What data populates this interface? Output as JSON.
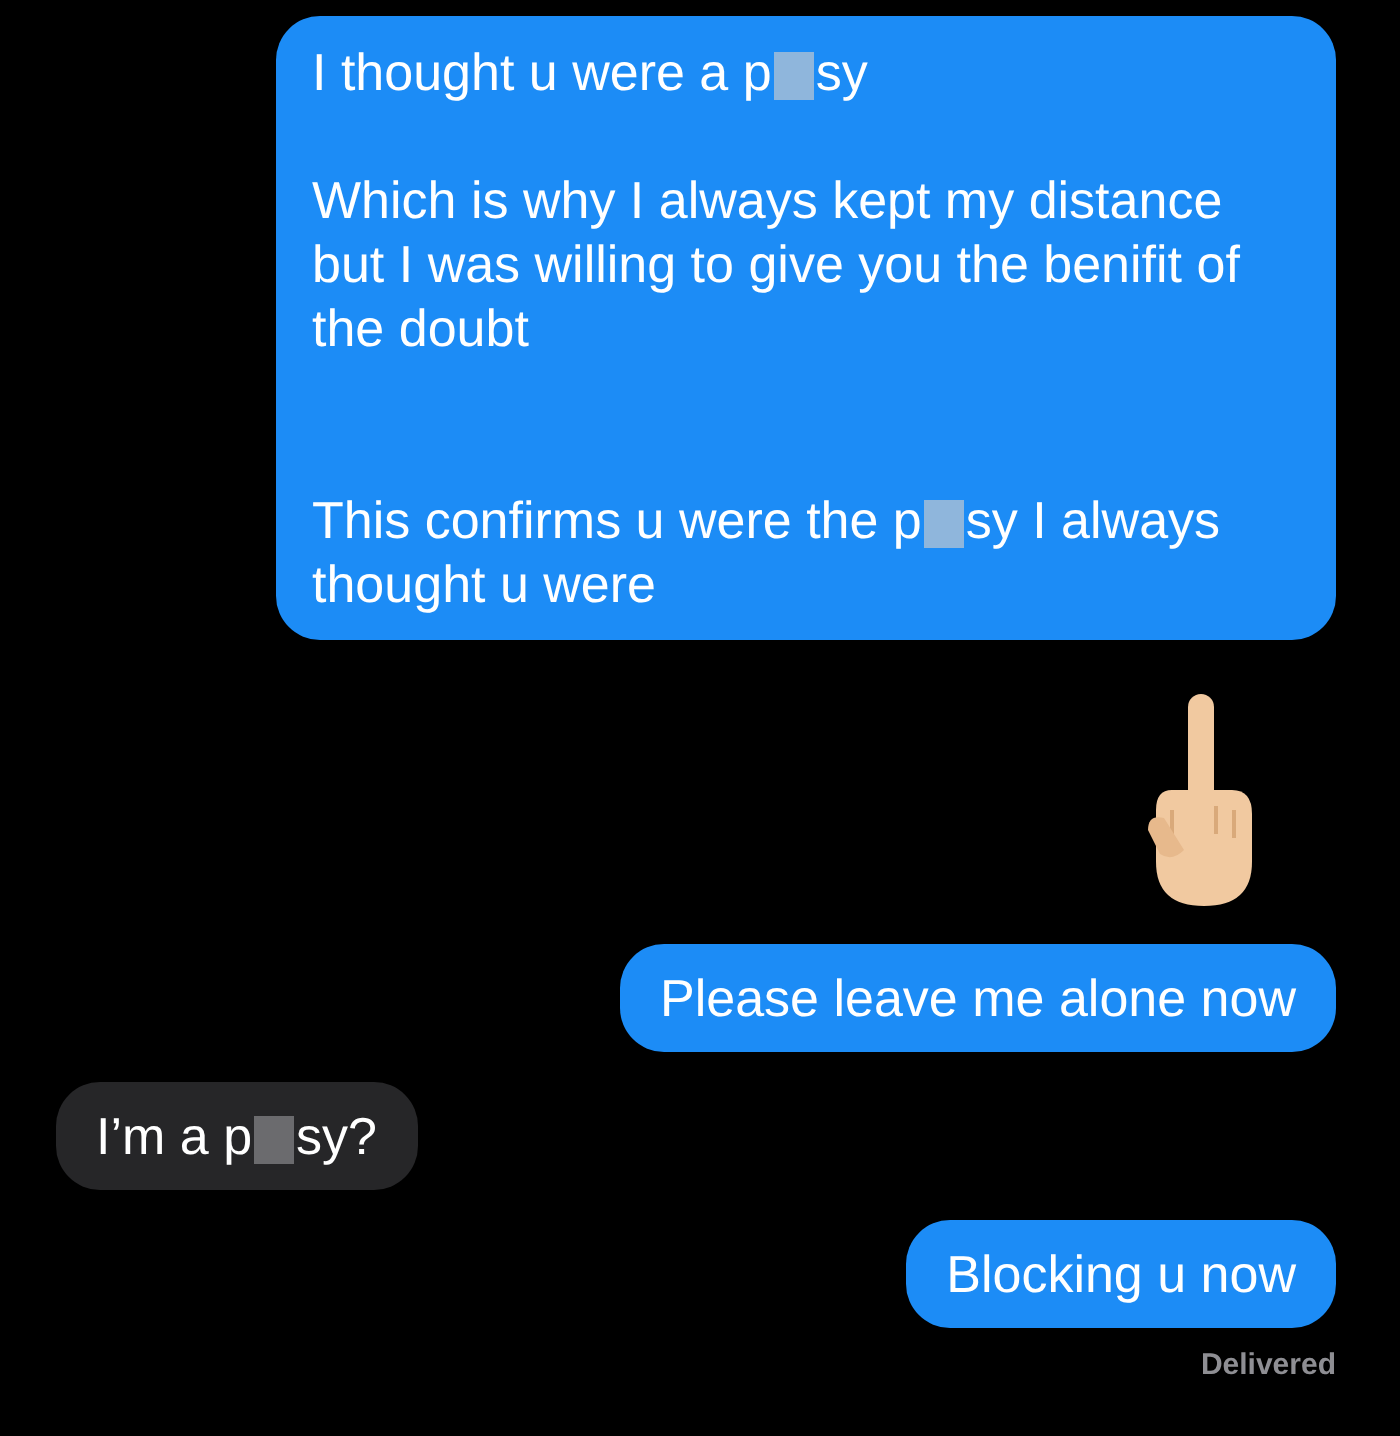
{
  "messages": [
    {
      "kind": "text",
      "outgoing": true,
      "paragraphs": [
        {
          "kind": "single_gap",
          "parts": [
            {
              "kind": "text",
              "text": "I thought u were a p"
            },
            {
              "kind": "censor"
            },
            {
              "kind": "text",
              "text": "sy"
            }
          ]
        },
        {
          "kind": "double_gap",
          "parts": [
            {
              "kind": "text",
              "text": "Which is why I always kept my distance but I was willing to give you the benifit of the doubt"
            }
          ]
        },
        {
          "kind": "plain",
          "parts": [
            {
              "kind": "text",
              "text": "This confirms u were the p"
            },
            {
              "kind": "censor"
            },
            {
              "kind": "text",
              "text": "sy I always"
            },
            {
              "kind": "break"
            },
            {
              "kind": "text",
              "text": "thought u were"
            }
          ]
        }
      ]
    },
    {
      "kind": "emoji"
    },
    {
      "kind": "text",
      "outgoing": true,
      "paragraphs": [
        {
          "kind": "plain",
          "parts": [
            {
              "kind": "text",
              "text": "Please leave me alone now"
            }
          ]
        }
      ]
    },
    {
      "kind": "text",
      "outgoing": false,
      "paragraphs": [
        {
          "kind": "plain",
          "parts": [
            {
              "kind": "text",
              "text": "I’m a p"
            },
            {
              "kind": "censor"
            },
            {
              "kind": "text",
              "text": "sy?"
            }
          ]
        }
      ]
    },
    {
      "kind": "text",
      "outgoing": true,
      "paragraphs": [
        {
          "kind": "plain",
          "parts": [
            {
              "kind": "text",
              "text": "Blocking u now"
            }
          ]
        }
      ]
    }
  ],
  "status": "Delivered"
}
